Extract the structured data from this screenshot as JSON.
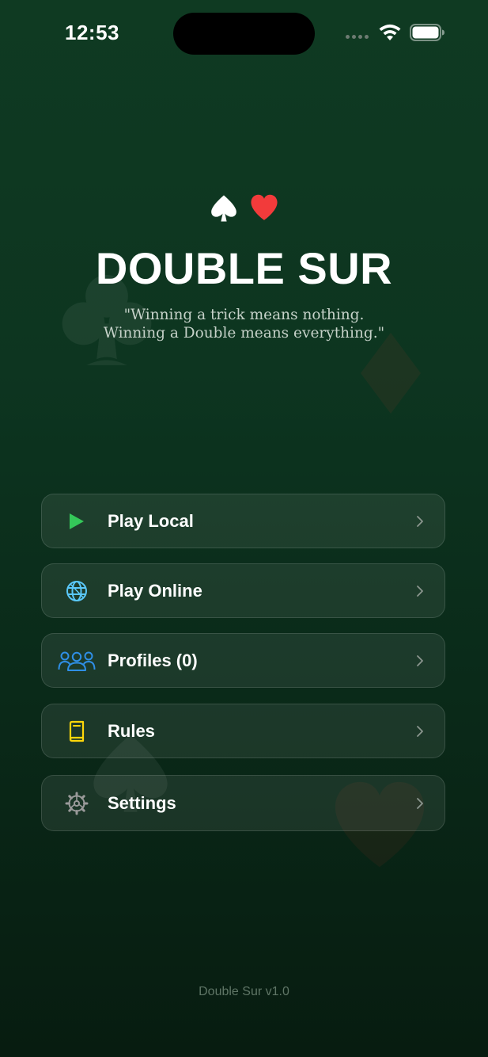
{
  "status_bar": {
    "time": "12:53",
    "icons": [
      "cellular-dots-icon",
      "wifi-icon",
      "battery-icon"
    ]
  },
  "header": {
    "suit_icons": [
      "spade-icon",
      "heart-icon"
    ],
    "title": "DOUBLE SUR",
    "tagline_line1": "\"Winning a trick means nothing.",
    "tagline_line2": "Winning a Double means everything.\""
  },
  "menu": {
    "items": [
      {
        "label": "Play Local",
        "icon": "play-icon",
        "color": "#34c759"
      },
      {
        "label": "Play Online",
        "icon": "globe-icon",
        "color": "#5ac8fa"
      },
      {
        "label": "Profiles (0)",
        "icon": "people-icon",
        "color": "#2f8fe6"
      },
      {
        "label": "Rules",
        "icon": "book-icon",
        "color": "#ffd60a"
      },
      {
        "label": "Settings",
        "icon": "gear-icon",
        "color": "#9a9a9a"
      }
    ]
  },
  "footer": {
    "version": "Double Sur v1.0"
  },
  "colors": {
    "background_top": "#0f3a22",
    "background_bottom": "#071c10",
    "heart_red": "#f23b3b",
    "tagline": "#c6d2c9",
    "version_text": "#5f7566"
  }
}
